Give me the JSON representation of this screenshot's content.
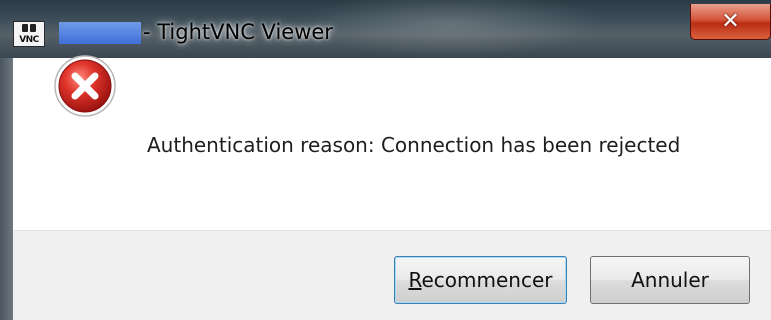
{
  "window": {
    "title": "- TightVNC Viewer",
    "icon": "tightvnc-app-icon",
    "icon_text": "VNC",
    "close_glyph": "✕"
  },
  "dialog": {
    "icon": "error-icon",
    "message": "Authentication reason: Connection has been rejected"
  },
  "buttons": {
    "retry": {
      "mnemonic": "R",
      "rest": "ecommencer"
    },
    "cancel": {
      "label": "Annuler"
    }
  },
  "colors": {
    "close_red": "#c8391c",
    "error_red": "#d02020",
    "redaction_blue": "#4a7ee0",
    "default_button_border": "#3c7fb1"
  }
}
